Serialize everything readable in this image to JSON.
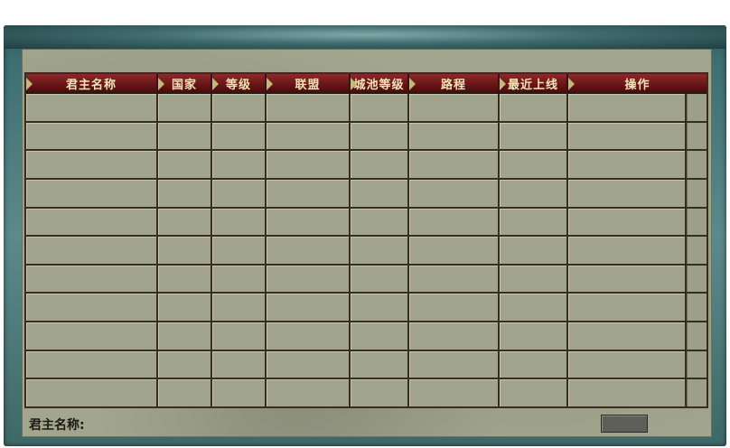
{
  "table": {
    "columns": [
      {
        "label": "君主名称"
      },
      {
        "label": "国家"
      },
      {
        "label": "等级"
      },
      {
        "label": "联盟"
      },
      {
        "label": "城池等级"
      },
      {
        "label": "路程"
      },
      {
        "label": "最近上线"
      },
      {
        "label": "操作"
      }
    ],
    "row_count": 11,
    "rows": []
  },
  "footer": {
    "lord_name_label": "君主名称:",
    "action_button_label": ""
  }
}
